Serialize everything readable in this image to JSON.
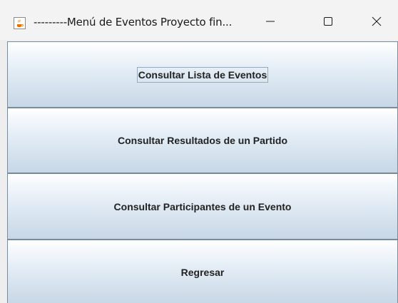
{
  "window": {
    "title": "---------Menú de Eventos Proyecto fin...",
    "app_icon": "java-coffee-icon",
    "controls": {
      "minimize_icon": "minimize-icon",
      "maximize_icon": "maximize-icon",
      "close_icon": "close-icon"
    }
  },
  "menu": {
    "buttons": [
      {
        "label": "Consultar Lista de Eventos"
      },
      {
        "label": "Consultar Resultados de un Partido"
      },
      {
        "label": "Consultar Participantes de un Evento"
      },
      {
        "label": "Regresar"
      }
    ]
  },
  "colors": {
    "title_bar": "#f3f3f3",
    "button_gradient_top": "#ffffff",
    "button_gradient_bottom": "#c7d7e6",
    "button_border": "#7a8a99"
  }
}
